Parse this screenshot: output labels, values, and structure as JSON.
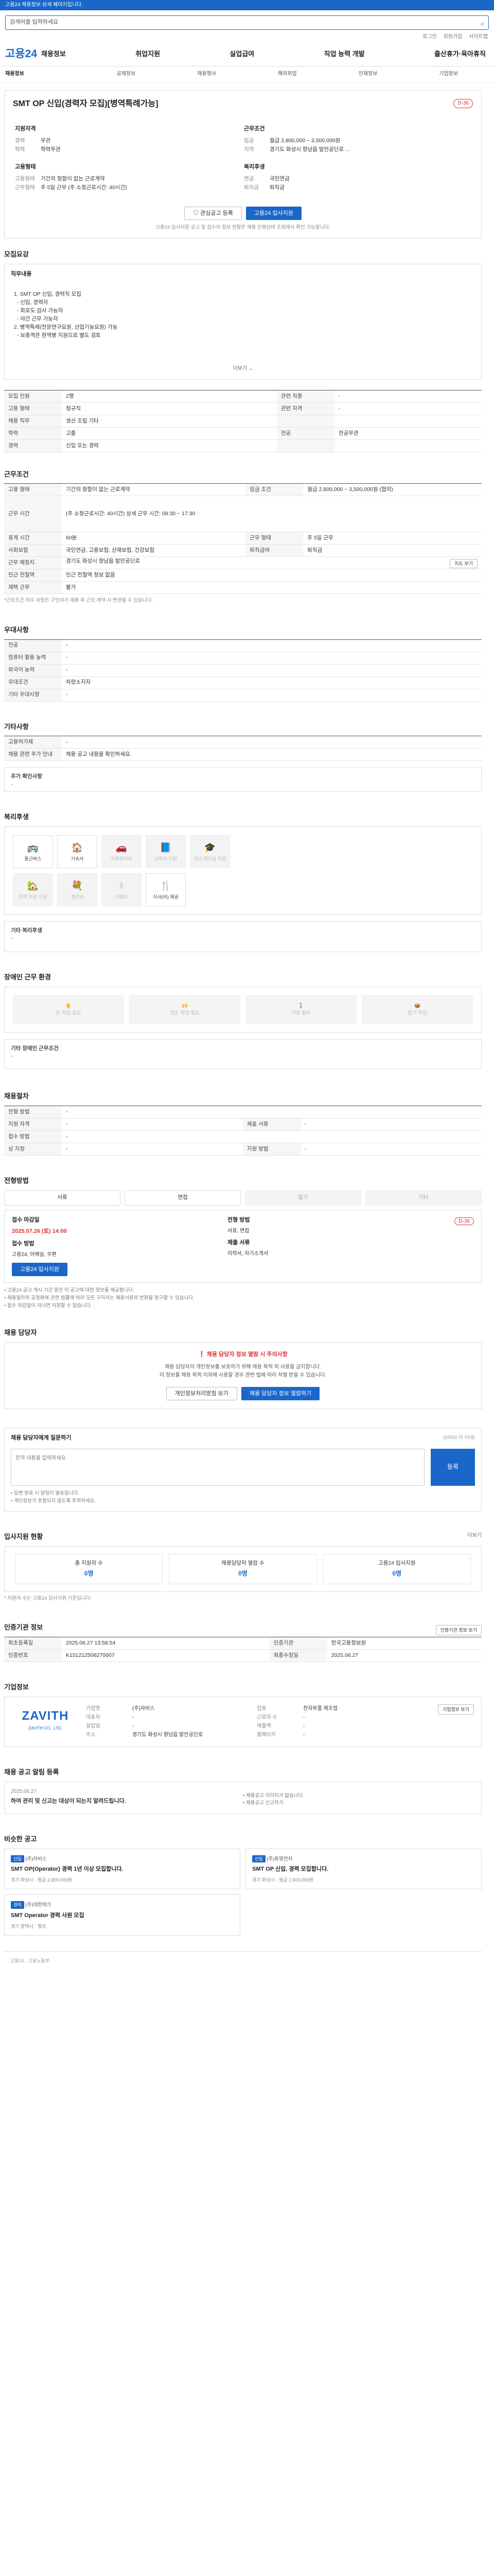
{
  "topbar": "고용24 채용정보 상세 페이지입니다.",
  "search": {
    "placeholder": "검색어를 입력하세요"
  },
  "util": [
    "로그인",
    "회원가입",
    "사이트맵"
  ],
  "logo": "고용24",
  "gnb": [
    "채용정보",
    "취업지원",
    "실업급여",
    "직업 능력 개발",
    "출산휴가·육아휴직"
  ],
  "subnav": [
    "채용정보",
    "공채정보",
    "채용행사",
    "해외취업",
    "인재정보",
    "기업정보"
  ],
  "job": {
    "title": "SMT OP 신입(경력자 모집)[병역특례가능]",
    "dday": "D-36",
    "qual_h": "지원자격",
    "cond_h": "근무조건",
    "qual": [
      {
        "k": "경력",
        "v": "무관"
      },
      {
        "k": "학력",
        "v": "학력무관"
      }
    ],
    "cond": [
      {
        "k": "임금",
        "v": "월급 2,800,000 ~ 3,500,000원"
      },
      {
        "k": "지역",
        "v": "경기도 화성시 향남읍 발안공단로 ..."
      }
    ],
    "form_h": "고용형태",
    "benefit_h": "복리후생",
    "form": [
      {
        "k": "고용형태",
        "v": "기간의 정함이 없는 근로계약"
      },
      {
        "k": "근무형태",
        "v": "주 5일 근무 (주 소정근로시간: 40시간)"
      }
    ],
    "benefit": [
      {
        "k": "연금",
        "v": "국민연금"
      },
      {
        "k": "퇴직금",
        "v": "퇴직금"
      }
    ],
    "btn_like": "관심공고 등록",
    "btn_apply": "고용24 입사지원",
    "note": "고용24 입사지원 공고 및 접수자 정보 현황은 채용 진행상태 조회에서 확인 가능합니다."
  },
  "summary": {
    "h": "모집요강",
    "work_h": "직무내용",
    "work": [
      "1. SMT OP 신입, 경력직 모집",
      "  - 신입, 경력자",
      "  - 회로도 검사 가능자",
      "  - 야간 근무 가능자",
      "",
      "2. 병역특례(전문연구요원, 산업기능요원) 가능",
      "  - 보충역은 현역병 지원으로 별도 검토"
    ],
    "more": "더보기"
  },
  "spec": [
    {
      "k": "모집 인원",
      "v": "2명",
      "k2": "관련 직종",
      "v2": "-"
    },
    {
      "k": "고용 형태",
      "v": "정규직",
      "k2": "관련 자격",
      "v2": "-"
    },
    {
      "k": "채용 직무",
      "v": "생산 조립 기타",
      "k2": "",
      "v2": ""
    },
    {
      "k": "학력",
      "v": "고졸",
      "k2": "전공",
      "v2": "전공무관"
    },
    {
      "k": "경력",
      "v": "신입 또는 경력",
      "k2": "",
      "v2": ""
    }
  ],
  "work_cond": {
    "h": "근무조건",
    "rows": [
      {
        "k": "고용 형태",
        "v": "기간의 정함이 없는 근로계약",
        "k2": "임금 조건",
        "v2": "월급 2,800,000 ~ 3,500,000원 (협의)"
      },
      {
        "k": "근무 시간",
        "v": "(주 소정근로시간: 40시간) 상세 근무 시간: 08:30 ~ 17:30",
        "k2": "",
        "v2": ""
      },
      {
        "k": "휴게 시간",
        "v": "60분",
        "k2": "근무 형태",
        "v2": "주 5일 근무"
      },
      {
        "k": "사회보험",
        "v": "국민연금, 고용보험, 산재보험, 건강보험",
        "k2": "퇴직급여",
        "v2": "퇴직금"
      },
      {
        "k": "근무 예정지",
        "v": "경기도 화성시 향남읍 발안공단로",
        "k2": "",
        "v2": ""
      },
      {
        "k": "인근 전철역",
        "v": "인근 전철역 정보 없음",
        "k2": "",
        "v2": ""
      },
      {
        "k": "재택 근무",
        "v": "불가",
        "k2": "",
        "v2": ""
      }
    ],
    "map_btn": "지도 보기",
    "note": "*근로조건 의무 사항은 구인자가 채용 후 근로 계약 시 변경될 수 있습니다."
  },
  "pref": {
    "h": "우대사항",
    "rows": [
      {
        "k": "전공",
        "v": "-"
      },
      {
        "k": "컴퓨터 활용 능력",
        "v": "-"
      },
      {
        "k": "외국어 능력",
        "v": "-"
      },
      {
        "k": "우대조건",
        "v": "차량소지자"
      },
      {
        "k": "기타 우대사항",
        "v": "-"
      }
    ]
  },
  "etc": {
    "h": "기타사항",
    "rows": [
      {
        "k": "고용허가제",
        "v": "-"
      },
      {
        "k": "채용 관련 추가 안내",
        "v": "채용 공고 내용을 확인하세요."
      },
      {
        "k": "장애인 채용",
        "v": "-"
      }
    ],
    "sub": "추가 확인사항"
  },
  "welfare": {
    "h": "복리후생",
    "items": [
      {
        "n": "통근버스",
        "icon": "🚌",
        "on": true
      },
      {
        "n": "기숙사",
        "icon": "🏠",
        "on": true
      },
      {
        "n": "차량유지비",
        "icon": "🚗",
        "on": false
      },
      {
        "n": "교육비 지원",
        "icon": "📘",
        "on": false
      },
      {
        "n": "자녀 학자금 지원",
        "icon": "🎓",
        "on": false
      }
    ],
    "items2": [
      {
        "n": "주택 자금 지원",
        "icon": "🏡",
        "on": false
      },
      {
        "n": "경조비",
        "icon": "💐",
        "on": false
      },
      {
        "n": "의료비",
        "icon": "⚕",
        "on": false
      },
      {
        "n": "식사(비) 제공",
        "icon": "🍴",
        "on": true
      }
    ],
    "etc_k": "기타 복리후생",
    "etc_v": "-"
  },
  "disabled": {
    "h": "장애인 근무 환경",
    "items": [
      "손 작업 필요",
      "양손 작업 필요",
      "이동 필요",
      "들기 작업"
    ],
    "etc_k": "기타 장애인 근무조건",
    "etc_v": "-"
  },
  "process": {
    "h": "채용절차",
    "rows": [
      {
        "k": "전형 방법",
        "v": "-",
        "k2": "",
        "v2": ""
      },
      {
        "k": "지원 자격",
        "v": "-",
        "k2": "제출 서류",
        "v2": "-"
      },
      {
        "k": "접수 방법",
        "v": "-",
        "k2": "",
        "v2": ""
      },
      {
        "k": "상 지정",
        "v": "-",
        "k2": "지원 방법",
        "v2": "-"
      }
    ]
  },
  "steps": {
    "h": "전형방법",
    "items": [
      {
        "n": "서류",
        "on": true
      },
      {
        "n": "면접",
        "on": true
      },
      {
        "n": "필기",
        "on": false
      },
      {
        "n": "기타",
        "on": false
      }
    ]
  },
  "schedule": {
    "period_k": "접수 마감일",
    "period_v": "2025.07.26 (토) 14:00",
    "method_k": "전형 방법",
    "method_v": "서류, 면접",
    "apply_k": "접수 방법",
    "apply_v": "고용24, 이메일, 우편",
    "submit_k": "제출 서류",
    "submit_v": "이력서, 자기소개서",
    "dday": "D-36",
    "btn": "고용24 입사지원",
    "bullets": [
      "• 고용24 공고 게시 기간 동안 이 공고에 대한 정보를 제공합니다.",
      "• 채용절차의 공정화에 관한 법률에 따라 모든 구직자는 채용서류의 반환을 청구할 수 있습니다.",
      "• 접수 마감일이 지나면 지원할 수 없습니다."
    ]
  },
  "contact": {
    "h": "채용 담당자",
    "t": "채용 담당자 정보 열람 시 주의사항",
    "p1": "채용 담당자의 개인정보를 보호하기 위해 채용 목적 외 사용을 금지합니다.",
    "p2": "이 정보를 채용 목적 이외에 사용할 경우 관련 법에 따라 처벌 받을 수 있습니다.",
    "btn1": "개인정보처리방침 보기",
    "btn2": "채용 담당자 정보 열람하기"
  },
  "inquiry": {
    "h": "채용 담당자에게 질문하기",
    "sub": "(0/500 자 이내)",
    "placeholder": "문의 내용을 입력하세요.",
    "btn": "등록",
    "notes": [
      "• 답변 완료 시 알림이 발송됩니다.",
      "• 개인정보가 포함되지 않도록 주의하세요."
    ]
  },
  "applicants": {
    "h": "입사지원 현황",
    "more": "더보기",
    "items": [
      {
        "k": "총 지원자 수",
        "v": "0명"
      },
      {
        "k": "채용담당자 열람 수",
        "v": "0명"
      },
      {
        "k": "고용24 입사지원",
        "v": "0명"
      }
    ],
    "note": "* 지원자 수는 고용24 입사지원 기준입니다."
  },
  "reg": {
    "h": "인증기관 정보",
    "btn": "인증기관 정보 보기",
    "rows": [
      {
        "k": "최초등록일",
        "v": "2025.06.27 13:58:54",
        "k2": "인증기관",
        "v2": "한국고용정보원"
      },
      {
        "k": "인증번호",
        "v": "K151212506270007",
        "k2": "최종수정일",
        "v2": "2025.06.27"
      }
    ]
  },
  "company": {
    "h": "기업정보",
    "logo": "ZAVITH",
    "logo_sub": "ZAVITH CO., LTD.",
    "btn": "기업정보 보기",
    "info": [
      {
        "k": "기업명",
        "v": "(주)자비스"
      },
      {
        "k": "업종",
        "v": "전자부품 제조업"
      },
      {
        "k": "대표자",
        "v": "-"
      },
      {
        "k": "근로자 수",
        "v": "-"
      },
      {
        "k": "설립일",
        "v": "-"
      },
      {
        "k": "매출액",
        "v": "-"
      },
      {
        "k": "주소",
        "v": "경기도 화성시 향남읍 발안공단로"
      },
      {
        "k": "홈페이지",
        "v": "-"
      }
    ]
  },
  "notice": {
    "h": "채용 공고 알림 등록",
    "date": "2025.06.27",
    "title": "하여 관리 및 신고는 대상이 되는지 알려드립니다.",
    "bullets": [
      "• 채용공고 이미지가 없습니다.",
      "• 채용공고 신고하기"
    ]
  },
  "similar": {
    "h": "비슷한 공고",
    "items": [
      {
        "b": "신입",
        "t": "SMT OP(Operator) 경력 1년 이상 모집합니다.",
        "c": "(주)자비스",
        "s": "경기 화성시 · 월급 2,800,000원"
      },
      {
        "b": "신입",
        "t": "SMT OP 신입, 경력 모집합니다.",
        "c": "(주)동명전자",
        "s": "경기 화성시 · 월급 2,900,000원"
      },
      {
        "b": "경력",
        "t": "SMT Operator 경력 사원 모집",
        "c": "(주)대한테크",
        "s": "경기 평택시 · 협의"
      }
    ]
  },
  "footer": "고용24 · 고용노동부"
}
